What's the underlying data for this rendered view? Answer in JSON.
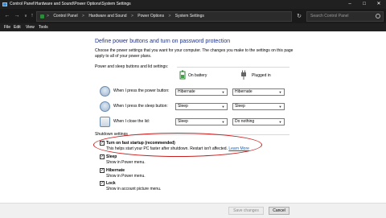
{
  "window": {
    "title": "Control Panel\\Hardware and Sound\\Power Options\\System Settings"
  },
  "address": {
    "crumbs": [
      "Control Panel",
      "Hardware and Sound",
      "Power Options",
      "System Settings"
    ],
    "separator": ">",
    "search_placeholder": "Search Control Panel"
  },
  "menu": [
    "File",
    "Edit",
    "View",
    "Tools"
  ],
  "page": {
    "title": "Define power buttons and turn on password protection",
    "description": "Choose the power settings that you want for your computer. The changes you make to the settings on this page apply to all of your power plans."
  },
  "power_section": {
    "label": "Power and sleep buttons and lid settings:",
    "on_battery": "On battery",
    "plugged_in": "Plugged in",
    "rows": [
      {
        "label": "When I press the power button:",
        "battery": "Hibernate",
        "plugged": "Hibernate"
      },
      {
        "label": "When I press the sleep button:",
        "battery": "Sleep",
        "plugged": "Sleep"
      },
      {
        "label": "When I close the lid:",
        "battery": "Sleep",
        "plugged": "Do nothing"
      }
    ]
  },
  "shutdown": {
    "label": "Shutdown settings",
    "items": [
      {
        "label": "Turn on fast startup (recommended)",
        "desc": "This helps start your PC faster after shutdown. Restart isn't affected.",
        "link": "Learn More",
        "checked": true
      },
      {
        "label": "Sleep",
        "desc": "Show in Power menu.",
        "checked": true
      },
      {
        "label": "Hibernate",
        "desc": "Show in Power menu.",
        "checked": true
      },
      {
        "label": "Lock",
        "desc": "Show in account picture menu.",
        "checked": true
      }
    ]
  },
  "buttons": {
    "save": "Save changes",
    "cancel": "Cancel"
  },
  "colors": {
    "title": "#1e3287",
    "link": "#0066cc",
    "highlight": "#c81e1e"
  }
}
